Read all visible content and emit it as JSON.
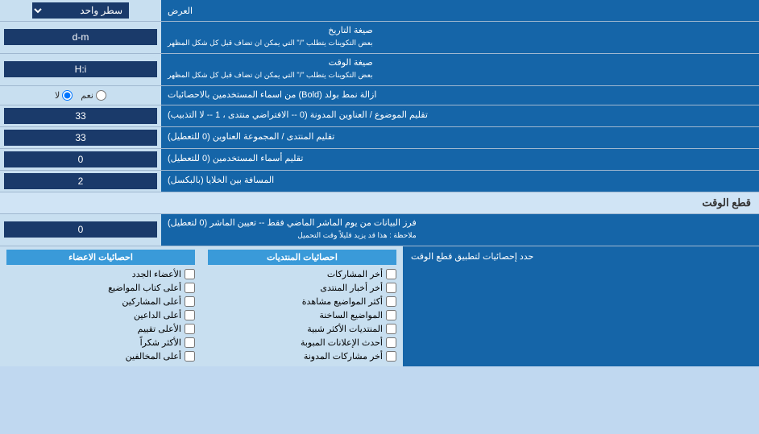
{
  "rows": [
    {
      "id": "display-mode",
      "label": "العرض",
      "input_type": "select",
      "value": "سطر واحد"
    },
    {
      "id": "date-format",
      "label": "صيغة التاريخ\nبعض التكوينات يتطلب \"/\" التي يمكن ان تضاف قبل كل شكل المظهر",
      "input_type": "text",
      "value": "d-m"
    },
    {
      "id": "time-format",
      "label": "صيغة الوقت\nبعض التكوينات يتطلب \"/\" التي يمكن ان تضاف قبل كل شكل المظهر",
      "input_type": "text",
      "value": "H:i"
    },
    {
      "id": "remove-bold",
      "label": "ازالة نمط بولد (Bold) من اسماء المستخدمين بالاحصائيات",
      "input_type": "radio",
      "options": [
        {
          "label": "نعم",
          "value": "yes"
        },
        {
          "label": "لا",
          "value": "no",
          "checked": true
        }
      ]
    },
    {
      "id": "topic-title-limit",
      "label": "تقليم الموضوع / العناوين المدونة (0 -- الافتراضي منتدى ، 1 -- لا التذبيب)",
      "input_type": "text",
      "value": "33"
    },
    {
      "id": "forum-header-limit",
      "label": "تقليم المنتدى / المجموعة العناوين (0 للتعطيل)",
      "input_type": "text",
      "value": "33"
    },
    {
      "id": "usernames-limit",
      "label": "تقليم أسماء المستخدمين (0 للتعطيل)",
      "input_type": "text",
      "value": "0"
    },
    {
      "id": "cell-spacing",
      "label": "المسافة بين الخلايا (بالبكسل)",
      "input_type": "text",
      "value": "2"
    }
  ],
  "cutoff_section": {
    "title": "قطع الوقت",
    "cutoff_row": {
      "label": "فرز البيانات من يوم الماشر الماضي فقط -- تعيين الماشر (0 لتعطيل)\nملاحظة : هذا قد يزيد قليلاً وقت التحميل",
      "value": "0"
    },
    "stats_label": "حدد إحصائيات لتطبيق قطع الوقت",
    "col1_header": "احصائيات المنتديات",
    "col2_header": "احصائيات الاعضاء",
    "col1_items": [
      "أخر المشاركات",
      "أخر أخبار المنتدى",
      "أكثر المواضيع مشاهدة",
      "المواضيع الساخنة",
      "المنتديات الأكثر شبية",
      "أحدث الإعلانات المبوبة",
      "أخر مشاركات المدونة"
    ],
    "col2_items": [
      "الأعضاء الجدد",
      "أعلى كتاب المواضيع",
      "أعلى المشاركين",
      "أعلى الداعين",
      "الأعلى تقييم",
      "الأكثر شكراً",
      "أعلى المخالفين"
    ]
  }
}
